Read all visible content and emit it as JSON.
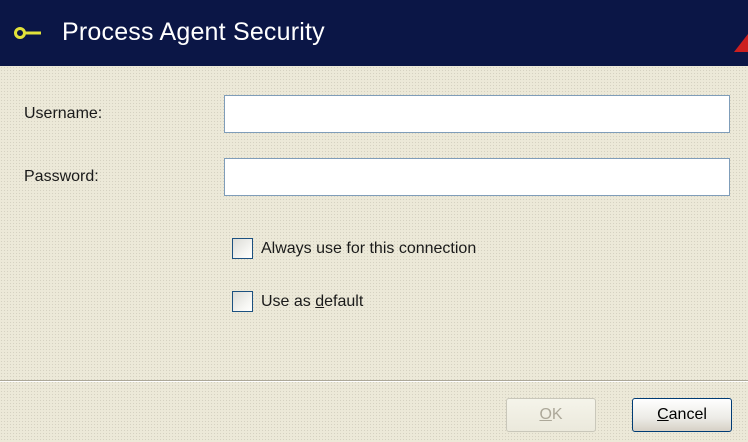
{
  "dialog": {
    "title": "Process Agent Security",
    "icons": {
      "title": "key-icon",
      "corner": "warning-triangle-icon"
    },
    "colors": {
      "titlebar": "#0b1646",
      "title_text": "#ffffff",
      "key_icon": "#e2e23a",
      "warning": "#cc1f1f",
      "background": "#ece9d8"
    }
  },
  "form": {
    "username": {
      "label": "Username:",
      "value": ""
    },
    "password": {
      "label": "Password:",
      "value": ""
    },
    "always_use": {
      "label": "Always use for this connection",
      "checked": false
    },
    "use_default": {
      "label_before": "Use as ",
      "label_underlined": "d",
      "label_after": "efault",
      "checked": false
    }
  },
  "buttons": {
    "ok": {
      "label_underlined": "O",
      "label_rest": "K",
      "enabled": false
    },
    "cancel": {
      "label_underlined": "C",
      "label_rest": "ancel",
      "enabled": true
    }
  }
}
